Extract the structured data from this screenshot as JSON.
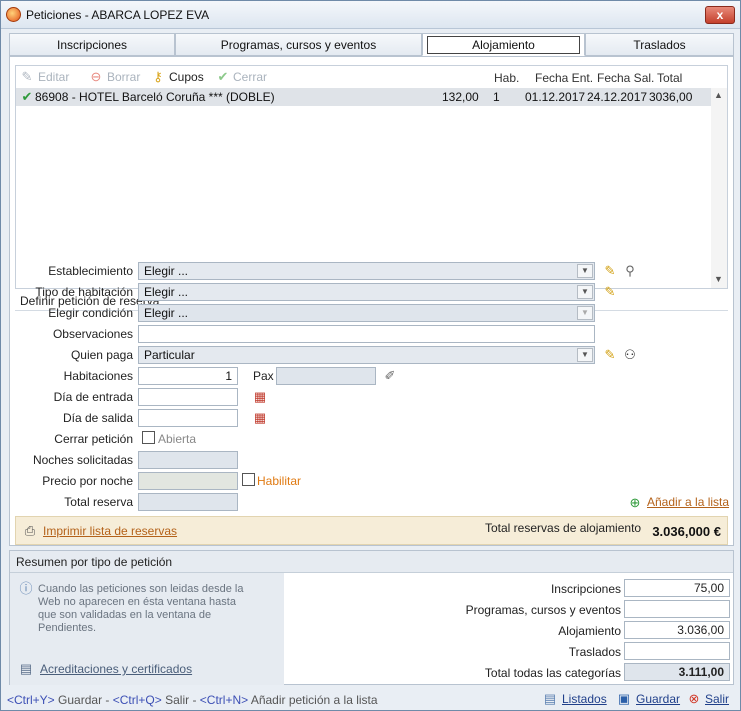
{
  "window": {
    "title": "Peticiones - ABARCA LOPEZ EVA",
    "close_label": "x"
  },
  "tabs": [
    {
      "label": "Inscripciones"
    },
    {
      "label": "Programas, cursos y eventos"
    },
    {
      "label": "Alojamiento"
    },
    {
      "label": "Traslados"
    }
  ],
  "toolbar": {
    "editar": "Editar",
    "borrar": "Borrar",
    "cupos": "Cupos",
    "cerrar": "Cerrar"
  },
  "columns": {
    "hab": "Hab.",
    "fecha_ent": "Fecha Ent.",
    "fecha_sal": "Fecha Sal.",
    "total": "Total"
  },
  "reservation": {
    "name": "86908 - HOTEL Barceló Coruña *** (DOBLE)",
    "price": "132,00",
    "hab": "1",
    "entry": "01.12.2017",
    "exit": "24.12.2017",
    "total": "3036,00"
  },
  "form": {
    "section_title": "Definir petición de reserva",
    "establecimiento_label": "Establecimiento",
    "establecimiento_value": "Elegir ...",
    "tipo_hab_label": "Tipo de habitación",
    "tipo_hab_value": "Elegir ...",
    "condicion_label": "Elegir condición",
    "condicion_value": "Elegir ...",
    "observaciones_label": "Observaciones",
    "observaciones_value": "",
    "quien_paga_label": "Quien paga",
    "quien_paga_value": "Particular",
    "habitaciones_label": "Habitaciones",
    "habitaciones_value": "1",
    "pax_label": "Pax",
    "pax_value": "",
    "entrada_label": "Día de entrada",
    "entrada_value": "",
    "salida_label": "Día de salida",
    "salida_value": "",
    "cerrar_label": "Cerrar petición",
    "cerrar_value": "Abierta",
    "noches_label": "Noches solicitadas",
    "noches_value": "",
    "precio_label": "Precio por noche",
    "precio_value": "",
    "habilitar_label": "Habilitar",
    "total_label": "Total reserva",
    "total_value": "",
    "add_link": "Añadir a la lista"
  },
  "print_bar": {
    "link": "Imprimir lista de reservas",
    "total_label": "Total reservas de alojamiento",
    "total_value": "3.036,000 €"
  },
  "resumen": {
    "title": "Resumen por tipo de petición",
    "info": "Cuando las peticiones son leidas desde la Web no aparecen en ésta ventana hasta que son validadas en la ventana de Pendientes.",
    "acred_link": "Acreditaciones y certificados",
    "rows": [
      {
        "label": "Inscripciones",
        "value": "75,00"
      },
      {
        "label": "Programas, cursos y eventos",
        "value": ""
      },
      {
        "label": "Alojamiento",
        "value": "3.036,00"
      },
      {
        "label": "Traslados",
        "value": ""
      },
      {
        "label": "Total todas las categorías",
        "value": "3.111,00"
      }
    ]
  },
  "statusbar": {
    "k1": "<Ctrl+Y>",
    "t1": " Guardar - ",
    "k2": "<Ctrl+Q>",
    "t2": " Salir - ",
    "k3": "<Ctrl+N>",
    "t3": " Añadir petición a la lista",
    "listados": "Listados",
    "guardar": "Guardar",
    "salir": "Salir"
  }
}
